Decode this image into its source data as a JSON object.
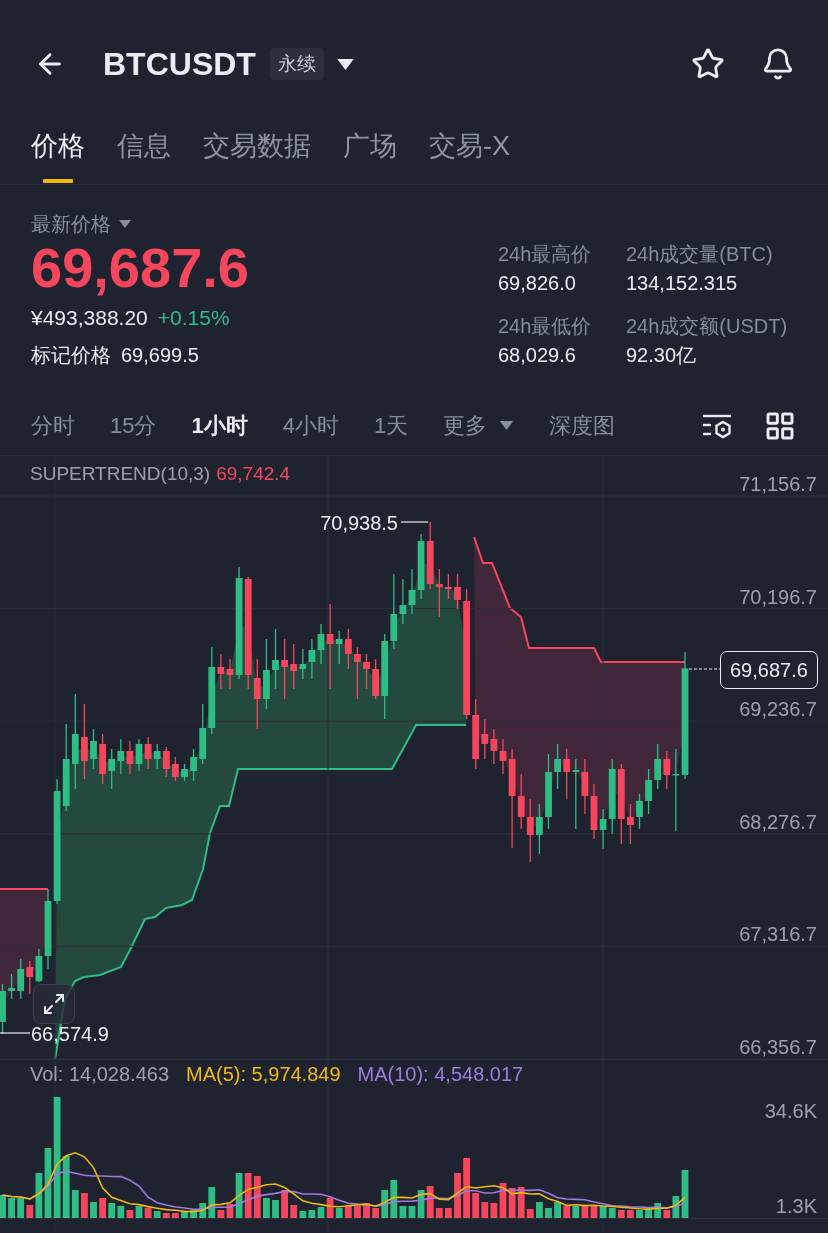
{
  "header": {
    "symbol": "BTCUSDT",
    "badge": "永续"
  },
  "tabs": [
    {
      "label": "价格",
      "selected": true
    },
    {
      "label": "信息",
      "selected": false
    },
    {
      "label": "交易数据",
      "selected": false
    },
    {
      "label": "广场",
      "selected": false
    },
    {
      "label": "交易-X",
      "selected": false
    }
  ],
  "price": {
    "label": "最新价格",
    "last_price": {
      "value": "69,687.6",
      "rising": false
    },
    "cny_price": "¥493,388.20",
    "change": {
      "value": "+0.15%",
      "rising": true
    },
    "mark_price": {
      "label": "标记价格",
      "value": "69,699.5"
    }
  },
  "stats": [
    {
      "label": "24h最高价",
      "value": "69,826.0"
    },
    {
      "label": "24h成交量(BTC)",
      "value": "134,152.315"
    },
    {
      "label": "24h最低价",
      "value": "68,029.6"
    },
    {
      "label": "24h成交额(USDT)",
      "value": "92.30亿"
    }
  ],
  "intervals": [
    {
      "label": "分时",
      "kind": "tab",
      "selected": false
    },
    {
      "label": "15分",
      "kind": "tab",
      "selected": false
    },
    {
      "label": "1小时",
      "kind": "tab",
      "selected": true
    },
    {
      "label": "4小时",
      "kind": "tab",
      "selected": false
    },
    {
      "label": "1天",
      "kind": "tab",
      "selected": false
    },
    {
      "label": "更多",
      "kind": "dropdown",
      "selected": false
    },
    {
      "label": "深度图",
      "kind": "tab",
      "selected": false
    }
  ],
  "chart": {
    "indicator": {
      "name": "SUPERTREND(10,3)",
      "value": "69,742.4",
      "rising": false
    },
    "high_marker": "70,938.5",
    "low_marker": "66,574.9",
    "last_price_tag": "69,687.6",
    "chart_data": {
      "type": "candlestick",
      "grid": true,
      "ohlc": [
        [
          66672.5,
          66996.4,
          66574.9,
          66936.7
        ],
        [
          66936.7,
          67081.7,
          66868.6,
          66962.3
        ],
        [
          66936.7,
          67209.5,
          66868.6,
          67124.3
        ],
        [
          67141.3,
          67192.5,
          66911.2,
          67056.1
        ],
        [
          67020.0,
          67294.8,
          67010.0,
          67235.1
        ],
        [
          67235.1,
          67806.3,
          67124.3,
          67704.0
        ],
        [
          67704.0,
          68744.1,
          67678.4,
          68641.8
        ],
        [
          68513.9,
          69213.0,
          68471.3,
          68914.6
        ],
        [
          68872.0,
          69468.7,
          68658.8,
          69127.7
        ],
        [
          69102.1,
          69383.5,
          68744.1,
          68897.5
        ],
        [
          68914.6,
          69170.3,
          68829.3,
          69068.0
        ],
        [
          69042.5,
          69127.7,
          68701.5,
          68786.7
        ],
        [
          68812.3,
          68999.8,
          68658.8,
          68914.6
        ],
        [
          68897.5,
          69085.1,
          68786.7,
          68982.8
        ],
        [
          68982.8,
          69068.0,
          68786.7,
          68872.0
        ],
        [
          68872.0,
          69085.1,
          68812.3,
          69042.5
        ],
        [
          69042.5,
          69102.1,
          68829.3,
          68914.6
        ],
        [
          68914.6,
          69042.5,
          68829.3,
          68982.8
        ],
        [
          68982.8,
          69016.9,
          68761.1,
          68829.3
        ],
        [
          68872.0,
          68931.6,
          68727.0,
          68761.1
        ],
        [
          68761.1,
          68872.0,
          68727.0,
          68829.3
        ],
        [
          68812.3,
          68999.8,
          68727.0,
          68931.6
        ],
        [
          68914.6,
          69383.5,
          68872.0,
          69178.8
        ],
        [
          69178.8,
          69869.4,
          69127.7,
          69698.9
        ],
        [
          69698.9,
          69809.7,
          69511.3,
          69639.2
        ],
        [
          69681.8,
          69767.1,
          69511.3,
          69630.7
        ],
        [
          69630.7,
          70551.4,
          69596.6,
          70457.6
        ],
        [
          70449.1,
          70466.1,
          69511.3,
          69630.7
        ],
        [
          69605.1,
          69767.1,
          69170.3,
          69426.1
        ],
        [
          69426.1,
          69937.6,
          69340.8,
          69673.3
        ],
        [
          69673.3,
          70022.8,
          69511.3,
          69758.6
        ],
        [
          69758.6,
          69937.6,
          69426.1,
          69698.9
        ],
        [
          69724.5,
          69895.0,
          69511.3,
          69664.8
        ],
        [
          69681.8,
          69852.3,
          69596.6,
          69724.5
        ],
        [
          69741.5,
          69937.6,
          69596.6,
          69843.8
        ],
        [
          69843.8,
          70065.5,
          69724.5,
          69980.2
        ],
        [
          69980.2,
          70236.0,
          69511.3,
          69895.0
        ],
        [
          69895.0,
          70005.8,
          69724.5,
          69937.6
        ],
        [
          69937.6,
          70022.8,
          69681.8,
          69809.7
        ],
        [
          69809.7,
          69869.4,
          69426.1,
          69741.5
        ],
        [
          69741.5,
          69809.7,
          69511.3,
          69681.8
        ],
        [
          69681.8,
          69767.1,
          69426.1,
          69451.6
        ],
        [
          69451.6,
          69980.2,
          69255.6,
          69920.6
        ],
        [
          69920.6,
          70491.7,
          69852.3,
          70150.7
        ],
        [
          70150.7,
          70449.1,
          70065.5,
          70227.5
        ],
        [
          70227.5,
          70534.3,
          70150.7,
          70355.3
        ],
        [
          70355.3,
          70832.7,
          70278.6,
          70773.0
        ],
        [
          70773.0,
          70938.5,
          70363.8,
          70406.5
        ],
        [
          70406.5,
          70534.3,
          70125.1,
          70380.9
        ],
        [
          70380.9,
          70491.7,
          70278.6,
          70363.8
        ],
        [
          70380.9,
          70491.7,
          70193.3,
          70270.1
        ],
        [
          70261.5,
          70363.8,
          69255.6,
          69289.7
        ],
        [
          69289.7,
          69426.1,
          68829.3,
          68914.6
        ],
        [
          69127.7,
          69255.6,
          68914.6,
          69042.5
        ],
        [
          69085.1,
          69170.3,
          68872.0,
          68982.8
        ],
        [
          68982.8,
          69085.1,
          68786.7,
          68897.5
        ],
        [
          68914.6,
          68999.8,
          68155.9,
          68599.2
        ],
        [
          68599.2,
          68786.7,
          68317.8,
          68420.1
        ],
        [
          68420.1,
          68573.6,
          68036.5,
          68266.7
        ],
        [
          68266.7,
          68531.0,
          68104.7,
          68420.1
        ],
        [
          68420.1,
          68957.2,
          68317.8,
          68803.8
        ],
        [
          68803.8,
          69042.5,
          68658.8,
          68914.6
        ],
        [
          68914.6,
          68999.8,
          68573.6,
          68803.8
        ],
        [
          68803.8,
          68914.6,
          68317.8,
          68820.8
        ],
        [
          68803.8,
          68914.6,
          68445.7,
          68599.2
        ],
        [
          68599.2,
          68701.5,
          68232.6,
          68309.3
        ],
        [
          68309.3,
          68488.3,
          68147.3,
          68403.1
        ],
        [
          68403.1,
          68914.6,
          68275.2,
          68829.3
        ],
        [
          68829.3,
          68872.0,
          68190.0,
          68403.1
        ],
        [
          68420.1,
          68531.0,
          68190.0,
          68352.0
        ],
        [
          68420.1,
          68616.2,
          68317.8,
          68556.5
        ],
        [
          68556.5,
          68829.3,
          68445.7,
          68735.6
        ],
        [
          68735.6,
          69042.5,
          68658.8,
          68914.6
        ],
        [
          68914.6,
          68982.8,
          68658.8,
          68778.2
        ],
        [
          68778.2,
          68999.8,
          68300.8,
          68786.7
        ],
        [
          68778.2,
          69826.0,
          68744.1,
          69687.6
        ]
      ],
      "ylim": [
        66356.7,
        71156.7
      ],
      "yticks": [
        {
          "value": 71156.7,
          "label": "71,156.7"
        },
        {
          "value": 70196.7,
          "label": "70,196.7"
        },
        {
          "value": 69236.7,
          "label": "69,236.7"
        },
        {
          "value": 68276.7,
          "label": "68,276.7"
        },
        {
          "value": 67316.7,
          "label": "67,316.7"
        },
        {
          "value": 66356.7,
          "label": "66,356.7"
        }
      ]
    }
  },
  "volume": {
    "vol": "Vol: 14,028.463",
    "ma5": "MA(5): 5,974.849",
    "ma10": "MA(10): 4,548.017",
    "y_axis_labels": [
      "34.6K",
      "1.3K"
    ]
  }
}
